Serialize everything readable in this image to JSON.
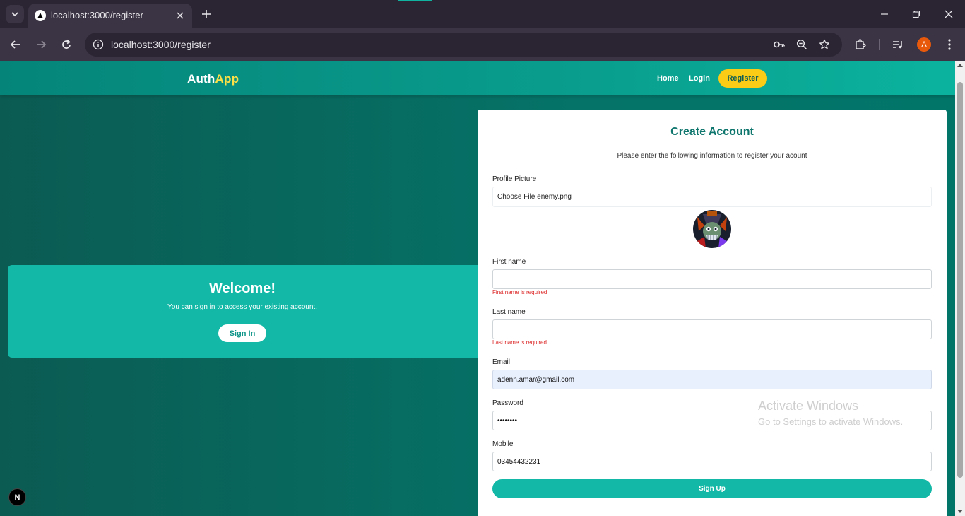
{
  "browser": {
    "tab_title": "localhost:3000/register",
    "url": "localhost:3000/register",
    "profile_initial": "A",
    "colors": {
      "frame": "#2a2433",
      "toolbar": "#3b3444"
    }
  },
  "navbar": {
    "brand_part1": "Auth",
    "brand_part2": "App",
    "links": {
      "home": "Home",
      "login": "Login",
      "register": "Register"
    },
    "colors": {
      "brand_accent": "#fde047",
      "register_bg": "#facc15"
    }
  },
  "welcome": {
    "title": "Welcome!",
    "text": "You can sign in to access your existing account.",
    "button": "Sign In"
  },
  "form": {
    "title": "Create Account",
    "subtitle": "Please enter the following information to register your acount",
    "profile_picture_label": "Profile Picture",
    "file_button": "Choose File",
    "file_name": "enemy.png",
    "first_name_label": "First name",
    "first_name_value": "",
    "first_name_error": "First name is required",
    "last_name_label": "Last name",
    "last_name_value": "",
    "last_name_error": "Last name is required",
    "email_label": "Email",
    "email_value": "adenn.amar@gmail.com",
    "password_label": "Password",
    "password_value": "••••••••",
    "mobile_label": "Mobile",
    "mobile_value": "03454432231",
    "submit": "Sign Up",
    "colors": {
      "primary": "#14b8a6",
      "title": "#0f766e",
      "error": "#dc2626"
    }
  },
  "watermark": {
    "title": "Activate Windows",
    "subtitle": "Go to Settings to activate Windows."
  },
  "dev_badge": "N"
}
